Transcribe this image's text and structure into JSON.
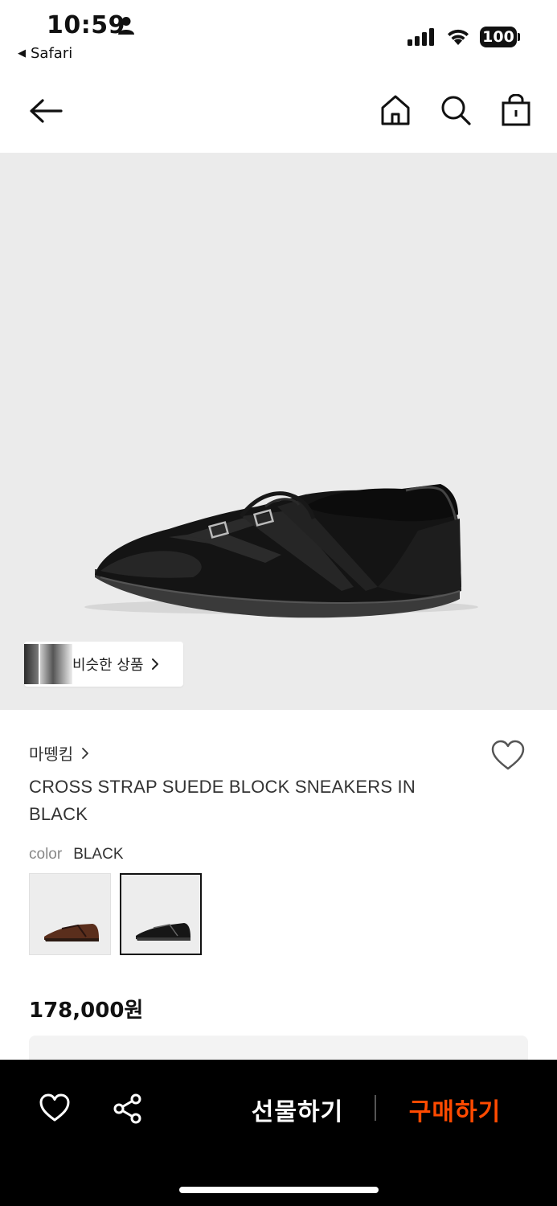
{
  "status_bar": {
    "time": "10:59",
    "back_app": "Safari",
    "battery": "100"
  },
  "nav": {
    "icons": [
      "back-arrow-icon",
      "home-icon",
      "search-icon",
      "shopping-bag-icon"
    ]
  },
  "hero": {
    "similar_label": "비슷한 상품"
  },
  "product": {
    "brand": "마뗑킴",
    "title": "CROSS STRAP SUEDE BLOCK SNEAKERS IN BLACK",
    "color_key": "color",
    "color_value": "BLACK",
    "swatches": [
      "brown",
      "black"
    ],
    "price": "178,000원"
  },
  "bottom_bar": {
    "gift_label": "선물하기",
    "buy_label": "구매하기",
    "buy_color": "#ff4a00"
  }
}
